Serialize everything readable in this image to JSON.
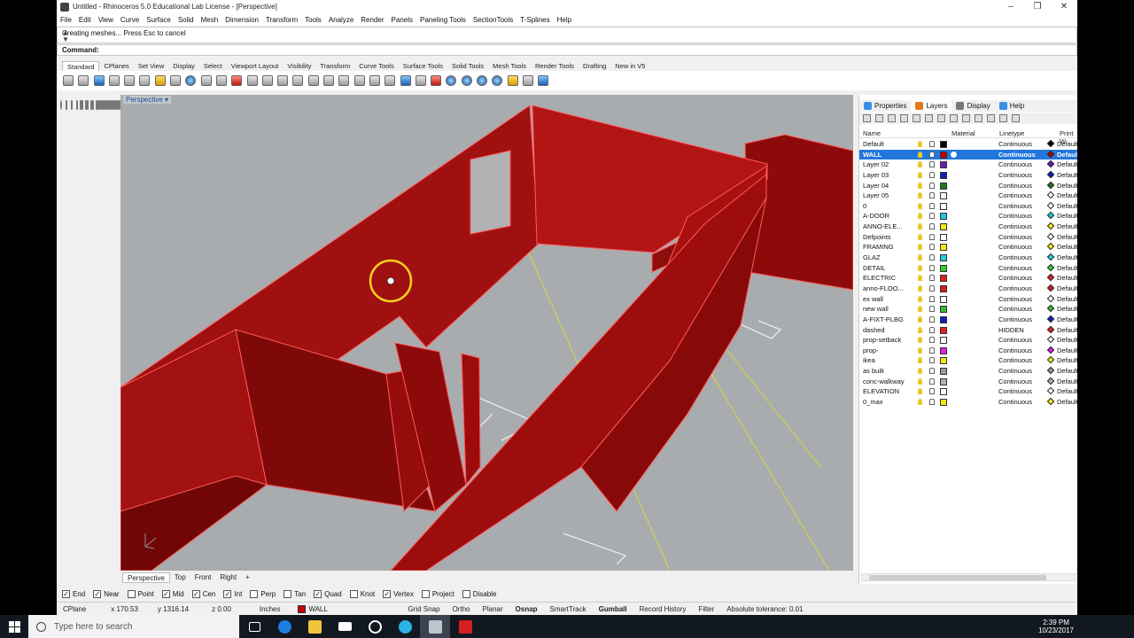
{
  "window": {
    "title": "Untitled - Rhinoceros 5.0 Educational Lab License - [Perspective]",
    "minimize": "–",
    "maximize": "❐",
    "close": "✕"
  },
  "menu": [
    "File",
    "Edit",
    "View",
    "Curve",
    "Surface",
    "Solid",
    "Mesh",
    "Dimension",
    "Transform",
    "Tools",
    "Analyze",
    "Render",
    "Panels",
    "Paneling Tools",
    "SectionTools",
    "T-Splines",
    "Help"
  ],
  "command": {
    "history": "Creating meshes... Press Esc to cancel",
    "prompt": "Command:"
  },
  "toolbar_tabs": [
    "Standard",
    "CPlanes",
    "Set View",
    "Display",
    "Select",
    "Viewport Layout",
    "Visibility",
    "Transform",
    "Curve Tools",
    "Surface Tools",
    "Solid Tools",
    "Mesh Tools",
    "Render Tools",
    "Drafting",
    "New in V5"
  ],
  "viewport": {
    "label": "Perspective",
    "tabs": [
      "Perspective",
      "Top",
      "Front",
      "Right"
    ],
    "add_tab": "+"
  },
  "panel": {
    "tabs": [
      "Properties",
      "Layers",
      "Display",
      "Help"
    ],
    "columns": {
      "name": "Name",
      "material": "Material",
      "linetype": "Linetype",
      "print": "Print W"
    },
    "layers": [
      {
        "name": "Default",
        "color": "#000000",
        "linetype": "Continuous",
        "print": "Default"
      },
      {
        "name": "WALL",
        "color": "#c00000",
        "linetype": "Continuous",
        "print": "Default"
      },
      {
        "name": "Layer 02",
        "color": "#6a1fb0",
        "linetype": "Continuous",
        "print": "Default"
      },
      {
        "name": "Layer 03",
        "color": "#1020c0",
        "linetype": "Continuous",
        "print": "Default"
      },
      {
        "name": "Layer 04",
        "color": "#1e7a1e",
        "linetype": "Continuous",
        "print": "Default"
      },
      {
        "name": "Layer 05",
        "color": "#ffffff",
        "linetype": "Continuous",
        "print": "Default"
      },
      {
        "name": "0",
        "color": "#ffffff",
        "linetype": "Continuous",
        "print": "Default"
      },
      {
        "name": "A-DOOR",
        "color": "#22c8e0",
        "linetype": "Continuous",
        "print": "Default"
      },
      {
        "name": "ANNO-ELE...",
        "color": "#f2e81a",
        "linetype": "Continuous",
        "print": "Default"
      },
      {
        "name": "Defpoints",
        "color": "#ffffff",
        "linetype": "Continuous",
        "print": "Default"
      },
      {
        "name": "FRAMING",
        "color": "#f2e81a",
        "linetype": "Continuous",
        "print": "Default"
      },
      {
        "name": "GLAZ",
        "color": "#22d0e0",
        "linetype": "Continuous",
        "print": "Default"
      },
      {
        "name": "DETAIL",
        "color": "#33cc33",
        "linetype": "Continuous",
        "print": "Default"
      },
      {
        "name": "ELECTRIC",
        "color": "#e02020",
        "linetype": "Continuous",
        "print": "Default"
      },
      {
        "name": "anno-FLOO...",
        "color": "#d02020",
        "linetype": "Continuous",
        "print": "Default"
      },
      {
        "name": "ex wall",
        "color": "#ffffff",
        "linetype": "Continuous",
        "print": "Default"
      },
      {
        "name": "new wall",
        "color": "#33bb33",
        "linetype": "Continuous",
        "print": "Default"
      },
      {
        "name": "A-FIXT-PLBG",
        "color": "#1020c0",
        "linetype": "Continuous",
        "print": "Default"
      },
      {
        "name": "dashed",
        "color": "#e02020",
        "linetype": "HIDDEN",
        "print": "Default"
      },
      {
        "name": "prop-setback",
        "color": "#ffffff",
        "linetype": "Continuous",
        "print": "Default"
      },
      {
        "name": "prop-",
        "color": "#e020e0",
        "linetype": "Continuous",
        "print": "Default"
      },
      {
        "name": "ikea",
        "color": "#f2e81a",
        "linetype": "Continuous",
        "print": "Default"
      },
      {
        "name": "as built",
        "color": "#9a9a9a",
        "linetype": "Continuous",
        "print": "Default"
      },
      {
        "name": "conc-walkway",
        "color": "#b0b0b0",
        "linetype": "Continuous",
        "print": "Default"
      },
      {
        "name": "ELEVATION",
        "color": "#ffffff",
        "linetype": "Continuous",
        "print": "Default"
      },
      {
        "name": "0_max",
        "color": "#f2e81a",
        "linetype": "Continuous",
        "print": "Default"
      }
    ]
  },
  "osnap": [
    {
      "label": "End",
      "checked": true
    },
    {
      "label": "Near",
      "checked": true
    },
    {
      "label": "Point",
      "checked": false
    },
    {
      "label": "Mid",
      "checked": true
    },
    {
      "label": "Cen",
      "checked": true
    },
    {
      "label": "Int",
      "checked": true
    },
    {
      "label": "Perp",
      "checked": false
    },
    {
      "label": "Tan",
      "checked": false
    },
    {
      "label": "Quad",
      "checked": true
    },
    {
      "label": "Knot",
      "checked": false
    },
    {
      "label": "Vertex",
      "checked": true
    },
    {
      "label": "Project",
      "checked": false
    },
    {
      "label": "Disable",
      "checked": false
    }
  ],
  "status": {
    "cplane": "CPlane",
    "x": "x 170.53",
    "y": "y 1316.14",
    "z": "z 0.00",
    "units": "Inches",
    "layer": "WALL",
    "layer_color": "#c80000",
    "toggles": [
      "Grid Snap",
      "Ortho",
      "Planar",
      "Osnap",
      "SmartTrack",
      "Gumball",
      "Record History",
      "Filter"
    ],
    "tolerance": "Absolute tolerance: 0.01"
  },
  "taskbar": {
    "search_placeholder": "Type here to search",
    "time": "2:39 PM",
    "date": "10/23/2017"
  }
}
